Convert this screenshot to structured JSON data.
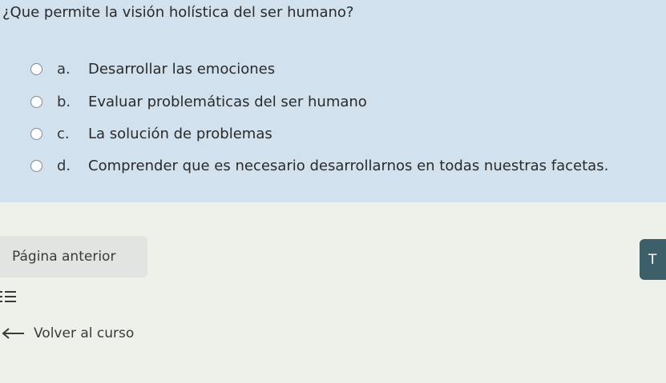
{
  "question": {
    "text": "¿Que permite la visión holística del ser humano?",
    "options": [
      {
        "letter": "a.",
        "text": "Desarrollar las emociones"
      },
      {
        "letter": "b.",
        "text": "Evaluar problemáticas del ser humano"
      },
      {
        "letter": "c.",
        "text": "La solución de problemas"
      },
      {
        "letter": "d.",
        "text": "Comprender que es necesario desarrollarnos en todas nuestras facetas."
      }
    ]
  },
  "navigation": {
    "previous_label": "Página anterior",
    "next_label": "T",
    "back_to_course_label": "Volver al curso"
  },
  "icons": {
    "list": "list-icon",
    "back": "arrow-left-icon"
  },
  "colors": {
    "question_background": "#d2e1ee",
    "next_button": "#3c5f69"
  }
}
